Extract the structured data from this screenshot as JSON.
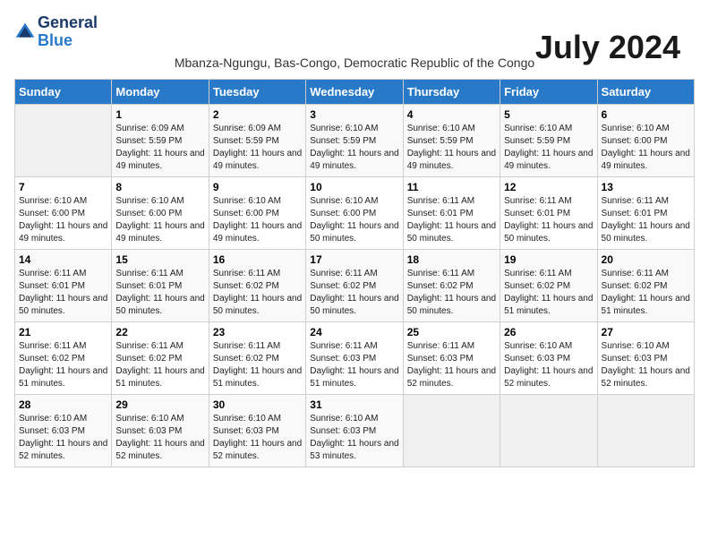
{
  "header": {
    "logo_line1": "General",
    "logo_line2": "Blue",
    "month_year": "July 2024",
    "location": "Mbanza-Ngungu, Bas-Congo, Democratic Republic of the Congo"
  },
  "weekdays": [
    "Sunday",
    "Monday",
    "Tuesday",
    "Wednesday",
    "Thursday",
    "Friday",
    "Saturday"
  ],
  "weeks": [
    [
      {
        "day": "",
        "sunrise": "",
        "sunset": "",
        "daylight": ""
      },
      {
        "day": "1",
        "sunrise": "Sunrise: 6:09 AM",
        "sunset": "Sunset: 5:59 PM",
        "daylight": "Daylight: 11 hours and 49 minutes."
      },
      {
        "day": "2",
        "sunrise": "Sunrise: 6:09 AM",
        "sunset": "Sunset: 5:59 PM",
        "daylight": "Daylight: 11 hours and 49 minutes."
      },
      {
        "day": "3",
        "sunrise": "Sunrise: 6:10 AM",
        "sunset": "Sunset: 5:59 PM",
        "daylight": "Daylight: 11 hours and 49 minutes."
      },
      {
        "day": "4",
        "sunrise": "Sunrise: 6:10 AM",
        "sunset": "Sunset: 5:59 PM",
        "daylight": "Daylight: 11 hours and 49 minutes."
      },
      {
        "day": "5",
        "sunrise": "Sunrise: 6:10 AM",
        "sunset": "Sunset: 5:59 PM",
        "daylight": "Daylight: 11 hours and 49 minutes."
      },
      {
        "day": "6",
        "sunrise": "Sunrise: 6:10 AM",
        "sunset": "Sunset: 6:00 PM",
        "daylight": "Daylight: 11 hours and 49 minutes."
      }
    ],
    [
      {
        "day": "7",
        "sunrise": "Sunrise: 6:10 AM",
        "sunset": "Sunset: 6:00 PM",
        "daylight": "Daylight: 11 hours and 49 minutes."
      },
      {
        "day": "8",
        "sunrise": "Sunrise: 6:10 AM",
        "sunset": "Sunset: 6:00 PM",
        "daylight": "Daylight: 11 hours and 49 minutes."
      },
      {
        "day": "9",
        "sunrise": "Sunrise: 6:10 AM",
        "sunset": "Sunset: 6:00 PM",
        "daylight": "Daylight: 11 hours and 49 minutes."
      },
      {
        "day": "10",
        "sunrise": "Sunrise: 6:10 AM",
        "sunset": "Sunset: 6:00 PM",
        "daylight": "Daylight: 11 hours and 50 minutes."
      },
      {
        "day": "11",
        "sunrise": "Sunrise: 6:11 AM",
        "sunset": "Sunset: 6:01 PM",
        "daylight": "Daylight: 11 hours and 50 minutes."
      },
      {
        "day": "12",
        "sunrise": "Sunrise: 6:11 AM",
        "sunset": "Sunset: 6:01 PM",
        "daylight": "Daylight: 11 hours and 50 minutes."
      },
      {
        "day": "13",
        "sunrise": "Sunrise: 6:11 AM",
        "sunset": "Sunset: 6:01 PM",
        "daylight": "Daylight: 11 hours and 50 minutes."
      }
    ],
    [
      {
        "day": "14",
        "sunrise": "Sunrise: 6:11 AM",
        "sunset": "Sunset: 6:01 PM",
        "daylight": "Daylight: 11 hours and 50 minutes."
      },
      {
        "day": "15",
        "sunrise": "Sunrise: 6:11 AM",
        "sunset": "Sunset: 6:01 PM",
        "daylight": "Daylight: 11 hours and 50 minutes."
      },
      {
        "day": "16",
        "sunrise": "Sunrise: 6:11 AM",
        "sunset": "Sunset: 6:02 PM",
        "daylight": "Daylight: 11 hours and 50 minutes."
      },
      {
        "day": "17",
        "sunrise": "Sunrise: 6:11 AM",
        "sunset": "Sunset: 6:02 PM",
        "daylight": "Daylight: 11 hours and 50 minutes."
      },
      {
        "day": "18",
        "sunrise": "Sunrise: 6:11 AM",
        "sunset": "Sunset: 6:02 PM",
        "daylight": "Daylight: 11 hours and 50 minutes."
      },
      {
        "day": "19",
        "sunrise": "Sunrise: 6:11 AM",
        "sunset": "Sunset: 6:02 PM",
        "daylight": "Daylight: 11 hours and 51 minutes."
      },
      {
        "day": "20",
        "sunrise": "Sunrise: 6:11 AM",
        "sunset": "Sunset: 6:02 PM",
        "daylight": "Daylight: 11 hours and 51 minutes."
      }
    ],
    [
      {
        "day": "21",
        "sunrise": "Sunrise: 6:11 AM",
        "sunset": "Sunset: 6:02 PM",
        "daylight": "Daylight: 11 hours and 51 minutes."
      },
      {
        "day": "22",
        "sunrise": "Sunrise: 6:11 AM",
        "sunset": "Sunset: 6:02 PM",
        "daylight": "Daylight: 11 hours and 51 minutes."
      },
      {
        "day": "23",
        "sunrise": "Sunrise: 6:11 AM",
        "sunset": "Sunset: 6:02 PM",
        "daylight": "Daylight: 11 hours and 51 minutes."
      },
      {
        "day": "24",
        "sunrise": "Sunrise: 6:11 AM",
        "sunset": "Sunset: 6:03 PM",
        "daylight": "Daylight: 11 hours and 51 minutes."
      },
      {
        "day": "25",
        "sunrise": "Sunrise: 6:11 AM",
        "sunset": "Sunset: 6:03 PM",
        "daylight": "Daylight: 11 hours and 52 minutes."
      },
      {
        "day": "26",
        "sunrise": "Sunrise: 6:10 AM",
        "sunset": "Sunset: 6:03 PM",
        "daylight": "Daylight: 11 hours and 52 minutes."
      },
      {
        "day": "27",
        "sunrise": "Sunrise: 6:10 AM",
        "sunset": "Sunset: 6:03 PM",
        "daylight": "Daylight: 11 hours and 52 minutes."
      }
    ],
    [
      {
        "day": "28",
        "sunrise": "Sunrise: 6:10 AM",
        "sunset": "Sunset: 6:03 PM",
        "daylight": "Daylight: 11 hours and 52 minutes."
      },
      {
        "day": "29",
        "sunrise": "Sunrise: 6:10 AM",
        "sunset": "Sunset: 6:03 PM",
        "daylight": "Daylight: 11 hours and 52 minutes."
      },
      {
        "day": "30",
        "sunrise": "Sunrise: 6:10 AM",
        "sunset": "Sunset: 6:03 PM",
        "daylight": "Daylight: 11 hours and 52 minutes."
      },
      {
        "day": "31",
        "sunrise": "Sunrise: 6:10 AM",
        "sunset": "Sunset: 6:03 PM",
        "daylight": "Daylight: 11 hours and 53 minutes."
      },
      {
        "day": "",
        "sunrise": "",
        "sunset": "",
        "daylight": ""
      },
      {
        "day": "",
        "sunrise": "",
        "sunset": "",
        "daylight": ""
      },
      {
        "day": "",
        "sunrise": "",
        "sunset": "",
        "daylight": ""
      }
    ]
  ]
}
